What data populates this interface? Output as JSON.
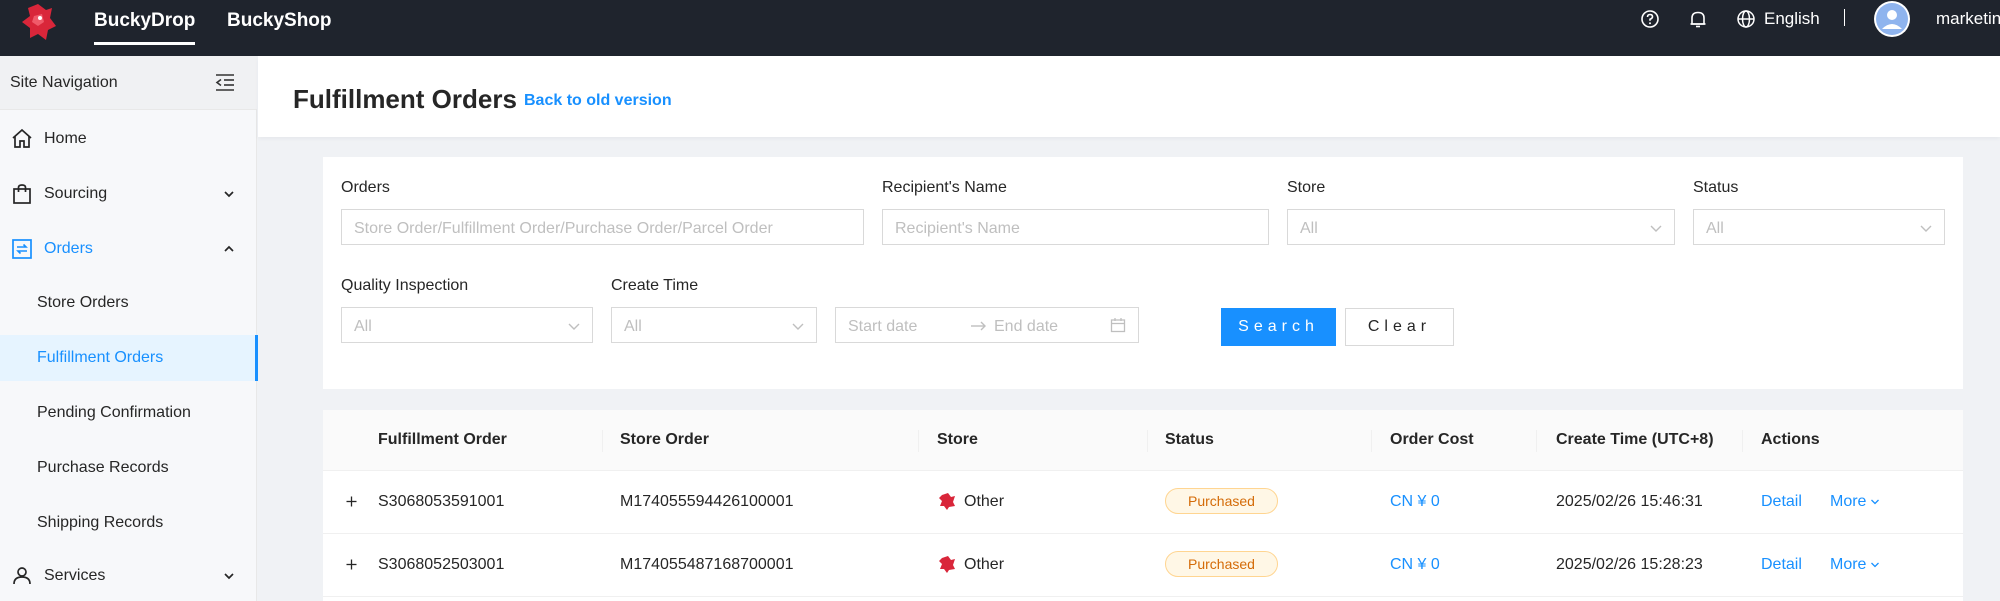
{
  "topbar": {
    "tabs": [
      "BuckyDrop",
      "BuckyShop"
    ],
    "language": "English",
    "username": "marketin"
  },
  "sidebar": {
    "title": "Site Navigation",
    "items": [
      {
        "label": "Home"
      },
      {
        "label": "Sourcing"
      },
      {
        "label": "Orders"
      }
    ],
    "orders_sub": [
      "Store Orders",
      "Fulfillment Orders",
      "Pending Confirmation",
      "Purchase Records",
      "Shipping Records"
    ],
    "services": "Services"
  },
  "header": {
    "title": "Fulfillment Orders",
    "back_link": "Back to old version"
  },
  "filters": {
    "orders_label": "Orders",
    "orders_placeholder": "Store Order/Fulfillment Order/Purchase Order/Parcel Order",
    "recipient_label": "Recipient's Name",
    "recipient_placeholder": "Recipient's Name",
    "store_label": "Store",
    "store_value": "All",
    "status_label": "Status",
    "status_value": "All",
    "qi_label": "Quality Inspection",
    "qi_value": "All",
    "create_time_label": "Create Time",
    "create_time_value": "All",
    "start_date": "Start date",
    "end_date": "End date",
    "search": "Search",
    "clear": "Clear"
  },
  "table": {
    "columns": [
      "Fulfillment Order",
      "Store Order",
      "Store",
      "Status",
      "Order Cost",
      "Create Time (UTC+8)",
      "Actions"
    ],
    "rows": [
      {
        "fulfillment": "S3068053591001",
        "store_order": "M174055594426100001",
        "store": "Other",
        "status": "Purchased",
        "cost": "CN ¥ 0",
        "time": "2025/02/26 15:46:31",
        "detail": "Detail",
        "more": "More"
      },
      {
        "fulfillment": "S3068052503001",
        "store_order": "M174055487168700001",
        "store": "Other",
        "status": "Purchased",
        "cost": "CN ¥ 0",
        "time": "2025/02/26 15:28:23",
        "detail": "Detail",
        "more": "More"
      }
    ]
  },
  "colors": {
    "primary": "#1890ff",
    "topbar": "#1f242d",
    "badge_text": "#d46b08",
    "badge_bg": "#fff7e6"
  }
}
